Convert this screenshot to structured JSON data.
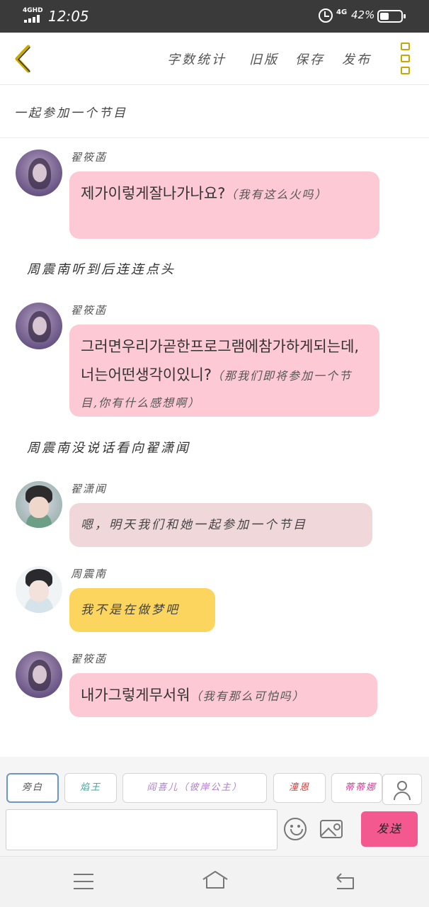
{
  "status_bar": {
    "network": "4GHD",
    "time": "12:05",
    "network_right": "4G",
    "battery_percent": "42%",
    "battery_level": 0.42,
    "icons": [
      "signal-icon",
      "alarm-icon",
      "battery-icon"
    ]
  },
  "toolbar": {
    "back_icon": "chevron-left-icon",
    "links": [
      "字数统计",
      "旧版",
      "保存",
      "发布"
    ],
    "more_icon": "more-vertical-icon",
    "accent_color": "#c9a800"
  },
  "story": {
    "title": "一起参加一个节目"
  },
  "messages": [
    {
      "type": "chat",
      "sender": "翟筱菡",
      "avatar": "girl-avatar",
      "bubble_color": "#fdc9d5",
      "text": "제가이렇게잘나가나요?",
      "note": "（我有这么火吗）"
    },
    {
      "type": "narration",
      "text": "周震南听到后连连点头"
    },
    {
      "type": "chat",
      "sender": "翟筱菡",
      "avatar": "girl-avatar",
      "bubble_color": "#fdc9d5",
      "text": "그러면우리가곧한프로그램에참가하게되는데,너는어떤생각이있니?",
      "note": "（那我们即将参加一个节目,你有什么感想啊）"
    },
    {
      "type": "narration",
      "text": "周震南没说话看向翟潇闻"
    },
    {
      "type": "chat",
      "sender": "翟潇闻",
      "avatar": "boy-avatar-1",
      "bubble_color": "#f0d8da",
      "text": "",
      "note": "嗯，明天我们和她一起参加一个节目"
    },
    {
      "type": "chat",
      "sender": "周震南",
      "avatar": "boy-avatar-2",
      "bubble_color": "#fbd55d",
      "text": "",
      "note": "我不是在做梦吧"
    },
    {
      "type": "chat",
      "sender": "翟筱菡",
      "avatar": "girl-avatar",
      "bubble_color": "#fdc9d5",
      "text": "내가그렇게무서워",
      "note": "（我有那么可怕吗）"
    }
  ],
  "roles": [
    {
      "label": "旁白",
      "color": "#555555",
      "selected": true
    },
    {
      "label": "焰王",
      "color": "#3aa6a0",
      "selected": false
    },
    {
      "label": "阎喜儿（彼岸公主）",
      "color": "#b07fd0",
      "selected": false
    },
    {
      "label": "潼恩",
      "color": "#d63a3a",
      "selected": false
    },
    {
      "label": "蒂蒂娜",
      "color": "#d4379a",
      "selected": false
    }
  ],
  "composer": {
    "input_value": "",
    "send_label": "发送",
    "send_color": "#f3588f",
    "icons": [
      "user-icon",
      "emoji-icon",
      "image-icon"
    ]
  },
  "nav": {
    "icons": [
      "menu-icon",
      "home-icon",
      "back-icon"
    ]
  }
}
